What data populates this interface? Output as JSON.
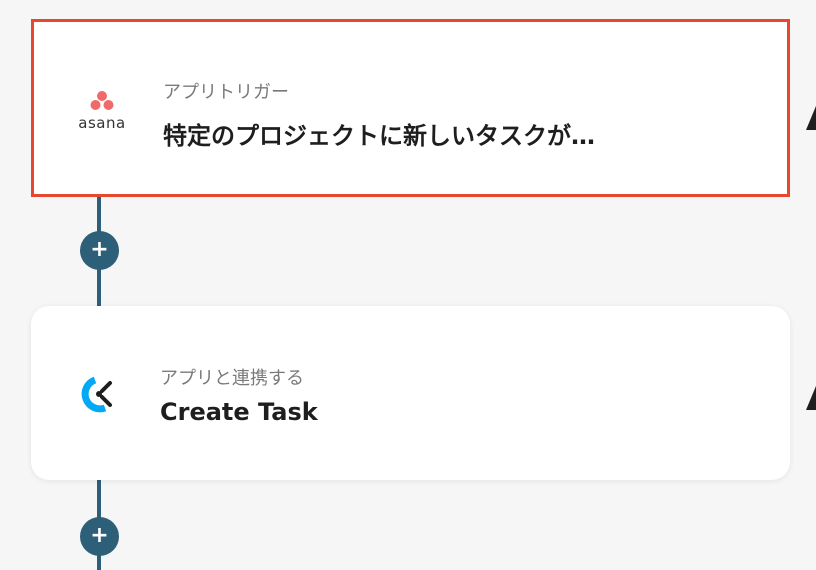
{
  "trigger": {
    "app_name": "asana",
    "subtitle": "アプリトリガー",
    "title": "特定のプロジェクトに新しいタスクが…",
    "icon": "asana-logo",
    "highlight_color": "#e8472e"
  },
  "action": {
    "subtitle": "アプリと連携する",
    "title": "Create Task",
    "icon": "clockify-logo"
  },
  "add_button": {
    "label": "+"
  },
  "colors": {
    "connector": "#2e5f78",
    "asana_pink": "#f06a6a",
    "clockify_blue": "#03a9f4"
  }
}
